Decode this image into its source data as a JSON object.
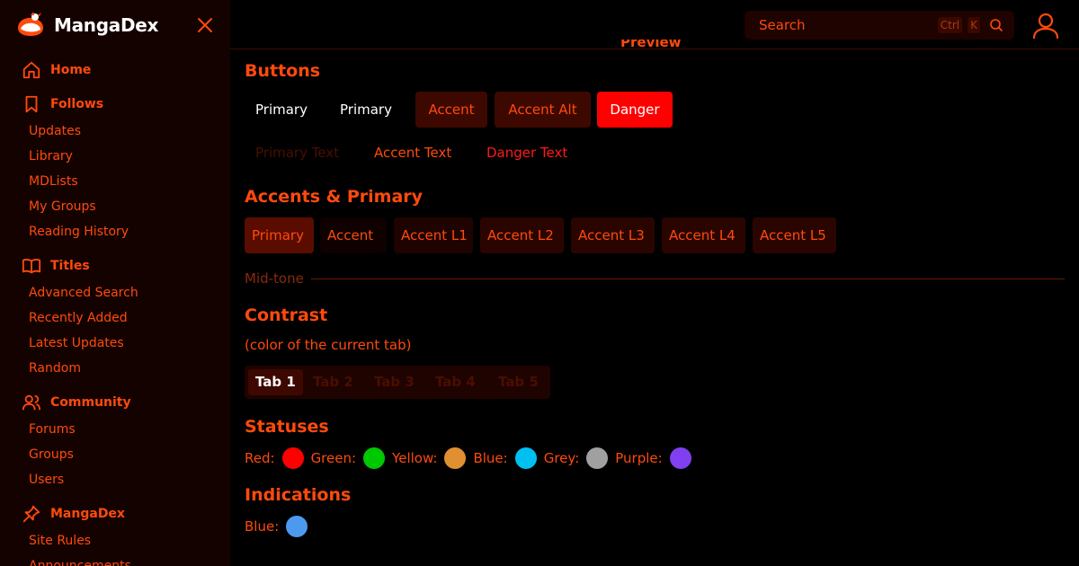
{
  "brand": {
    "name": "MangaDex"
  },
  "sidebar": {
    "sections": [
      {
        "label": "Home",
        "icon": "home-icon",
        "items": []
      },
      {
        "label": "Follows",
        "icon": "bookmark-icon",
        "items": [
          "Updates",
          "Library",
          "MDLists",
          "My Groups",
          "Reading History"
        ]
      },
      {
        "label": "Titles",
        "icon": "book-open-icon",
        "items": [
          "Advanced Search",
          "Recently Added",
          "Latest Updates",
          "Random"
        ]
      },
      {
        "label": "Community",
        "icon": "users-icon",
        "items": [
          "Forums",
          "Groups",
          "Users"
        ]
      },
      {
        "label": "MangaDex",
        "icon": "pin-icon",
        "items": [
          "Site Rules",
          "Announcements"
        ]
      }
    ]
  },
  "header": {
    "search_placeholder": "Search",
    "shortcut_ctrl": "Ctrl",
    "shortcut_key": "K"
  },
  "main": {
    "peek_label": "Preview",
    "buttons_heading": "Buttons",
    "buttons": [
      "Primary",
      "Primary",
      "Accent",
      "Accent Alt",
      "Danger"
    ],
    "text_buttons": [
      "Primary Text",
      "Accent Text",
      "Danger Text"
    ],
    "accents_heading": "Accents & Primary",
    "accents": [
      "Primary",
      "Accent",
      "Accent L1",
      "Accent L2",
      "Accent L3",
      "Accent L4",
      "Accent L5"
    ],
    "midtone_label": "Mid-tone",
    "contrast_heading": "Contrast",
    "contrast_note": "(color of the current tab)",
    "tabs": [
      "Tab 1",
      "Tab 2",
      "Tab 3",
      "Tab 4",
      "Tab 5"
    ],
    "statuses_heading": "Statuses",
    "statuses": [
      {
        "label": "Red:",
        "color": "#ff0000"
      },
      {
        "label": "Green:",
        "color": "#00c800"
      },
      {
        "label": "Yellow:",
        "color": "#e09030"
      },
      {
        "label": "Blue:",
        "color": "#00c0f0"
      },
      {
        "label": "Grey:",
        "color": "#a0a0a0"
      },
      {
        "label": "Purple:",
        "color": "#8040f0"
      }
    ],
    "indications_heading": "Indications",
    "indications": [
      {
        "label": "Blue:",
        "color": "#4c9af0"
      }
    ]
  },
  "colors": {
    "accent": "#ff4a0c",
    "sidebar_bg": "#140200",
    "danger": "#ff0000"
  }
}
